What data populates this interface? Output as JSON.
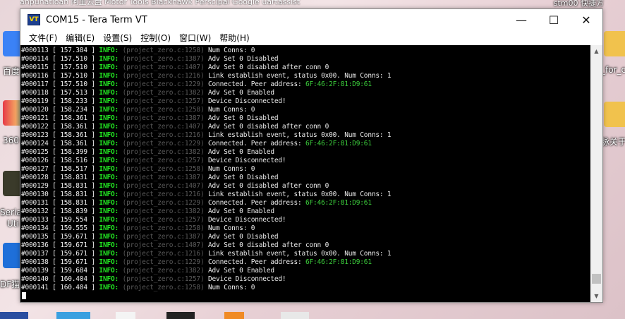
{
  "window": {
    "title": "COM15 - Tera Term VT",
    "app_icon_text": "VT",
    "controls": {
      "minimize": "—",
      "maximize": "☐",
      "close": "✕"
    }
  },
  "menu": [
    "文件(F)",
    "编辑(E)",
    "设置(S)",
    "控制(O)",
    "窗口(W)",
    "帮助(H)"
  ],
  "desktop": {
    "top_text": "anpunatioan  阿里云盘  Motor Tools  Blackhawk  Perscipal  Google  uartassist",
    "top_right_text": "stm00 快捷方",
    "icon_labels": {
      "left_1": "百度",
      "left_2": "360",
      "left_3": "Seria",
      "left_3b": "Uti",
      "left_4": "DF猫",
      "right_1": "_for_c",
      "right_2": "脉关于"
    }
  },
  "terminal": {
    "lines": [
      {
        "id": "#000113",
        "ts": "[ 157.384 ]",
        "lvl": "INFO:",
        "src": "(project_zero.c:1258)",
        "msg": "Num Conns: 0",
        "addr": ""
      },
      {
        "id": "#000114",
        "ts": "[ 157.510 ]",
        "lvl": "INFO:",
        "src": "(project_zero.c:1387)",
        "msg": "Adv Set 0 Disabled",
        "addr": ""
      },
      {
        "id": "#000115",
        "ts": "[ 157.510 ]",
        "lvl": "INFO:",
        "src": "(project_zero.c:1407)",
        "msg": "Adv Set 0 disabled after conn 0",
        "addr": ""
      },
      {
        "id": "#000116",
        "ts": "[ 157.510 ]",
        "lvl": "INFO:",
        "src": "(project_zero.c:1216)",
        "msg": "Link establish event, status 0x00. Num Conns: 1",
        "addr": ""
      },
      {
        "id": "#000117",
        "ts": "[ 157.510 ]",
        "lvl": "INFO:",
        "src": "(project_zero.c:1229)",
        "msg": "Connected. Peer address: ",
        "addr": "6F:46:2F:81:D9:61"
      },
      {
        "id": "#000118",
        "ts": "[ 157.513 ]",
        "lvl": "INFO:",
        "src": "(project_zero.c:1382)",
        "msg": "Adv Set 0 Enabled",
        "addr": ""
      },
      {
        "id": "#000119",
        "ts": "[ 158.233 ]",
        "lvl": "INFO:",
        "src": "(project_zero.c:1257)",
        "msg": "Device Disconnected!",
        "addr": ""
      },
      {
        "id": "#000120",
        "ts": "[ 158.234 ]",
        "lvl": "INFO:",
        "src": "(project_zero.c:1258)",
        "msg": "Num Conns: 0",
        "addr": ""
      },
      {
        "id": "#000121",
        "ts": "[ 158.361 ]",
        "lvl": "INFO:",
        "src": "(project_zero.c:1387)",
        "msg": "Adv Set 0 Disabled",
        "addr": ""
      },
      {
        "id": "#000122",
        "ts": "[ 158.361 ]",
        "lvl": "INFO:",
        "src": "(project_zero.c:1407)",
        "msg": "Adv Set 0 disabled after conn 0",
        "addr": ""
      },
      {
        "id": "#000123",
        "ts": "[ 158.361 ]",
        "lvl": "INFO:",
        "src": "(project_zero.c:1216)",
        "msg": "Link establish event, status 0x00. Num Conns: 1",
        "addr": ""
      },
      {
        "id": "#000124",
        "ts": "[ 158.361 ]",
        "lvl": "INFO:",
        "src": "(project_zero.c:1229)",
        "msg": "Connected. Peer address: ",
        "addr": "6F:46:2F:81:D9:61"
      },
      {
        "id": "#000125",
        "ts": "[ 158.399 ]",
        "lvl": "INFO:",
        "src": "(project_zero.c:1382)",
        "msg": "Adv Set 0 Enabled",
        "addr": ""
      },
      {
        "id": "#000126",
        "ts": "[ 158.516 ]",
        "lvl": "INFO:",
        "src": "(project_zero.c:1257)",
        "msg": "Device Disconnected!",
        "addr": ""
      },
      {
        "id": "#000127",
        "ts": "[ 158.517 ]",
        "lvl": "INFO:",
        "src": "(project_zero.c:1258)",
        "msg": "Num Conns: 0",
        "addr": ""
      },
      {
        "id": "#000128",
        "ts": "[ 158.831 ]",
        "lvl": "INFO:",
        "src": "(project_zero.c:1387)",
        "msg": "Adv Set 0 Disabled",
        "addr": ""
      },
      {
        "id": "#000129",
        "ts": "[ 158.831 ]",
        "lvl": "INFO:",
        "src": "(project_zero.c:1407)",
        "msg": "Adv Set 0 disabled after conn 0",
        "addr": ""
      },
      {
        "id": "#000130",
        "ts": "[ 158.831 ]",
        "lvl": "INFO:",
        "src": "(project_zero.c:1216)",
        "msg": "Link establish event, status 0x00. Num Conns: 1",
        "addr": ""
      },
      {
        "id": "#000131",
        "ts": "[ 158.831 ]",
        "lvl": "INFO:",
        "src": "(project_zero.c:1229)",
        "msg": "Connected. Peer address: ",
        "addr": "6F:46:2F:81:D9:61"
      },
      {
        "id": "#000132",
        "ts": "[ 158.839 ]",
        "lvl": "INFO:",
        "src": "(project_zero.c:1382)",
        "msg": "Adv Set 0 Enabled",
        "addr": ""
      },
      {
        "id": "#000133",
        "ts": "[ 159.554 ]",
        "lvl": "INFO:",
        "src": "(project_zero.c:1257)",
        "msg": "Device Disconnected!",
        "addr": ""
      },
      {
        "id": "#000134",
        "ts": "[ 159.555 ]",
        "lvl": "INFO:",
        "src": "(project_zero.c:1258)",
        "msg": "Num Conns: 0",
        "addr": ""
      },
      {
        "id": "#000135",
        "ts": "[ 159.671 ]",
        "lvl": "INFO:",
        "src": "(project_zero.c:1387)",
        "msg": "Adv Set 0 Disabled",
        "addr": ""
      },
      {
        "id": "#000136",
        "ts": "[ 159.671 ]",
        "lvl": "INFO:",
        "src": "(project_zero.c:1407)",
        "msg": "Adv Set 0 disabled after conn 0",
        "addr": ""
      },
      {
        "id": "#000137",
        "ts": "[ 159.671 ]",
        "lvl": "INFO:",
        "src": "(project_zero.c:1216)",
        "msg": "Link establish event, status 0x00. Num Conns: 1",
        "addr": ""
      },
      {
        "id": "#000138",
        "ts": "[ 159.671 ]",
        "lvl": "INFO:",
        "src": "(project_zero.c:1229)",
        "msg": "Connected. Peer address: ",
        "addr": "6F:46:2F:81:D9:61"
      },
      {
        "id": "#000139",
        "ts": "[ 159.684 ]",
        "lvl": "INFO:",
        "src": "(project_zero.c:1382)",
        "msg": "Adv Set 0 Enabled",
        "addr": ""
      },
      {
        "id": "#000140",
        "ts": "[ 160.404 ]",
        "lvl": "INFO:",
        "src": "(project_zero.c:1257)",
        "msg": "Device Disconnected!",
        "addr": ""
      },
      {
        "id": "#000141",
        "ts": "[ 160.404 ]",
        "lvl": "INFO:",
        "src": "(project_zero.c:1258)",
        "msg": "Num Conns: 0",
        "addr": ""
      }
    ],
    "scroll_position": 0.97
  },
  "colors": {
    "terminal_bg": "#000000",
    "info_green": "#22e622",
    "address_green": "#3ccf3c",
    "source_gray": "#5a5a5a"
  }
}
